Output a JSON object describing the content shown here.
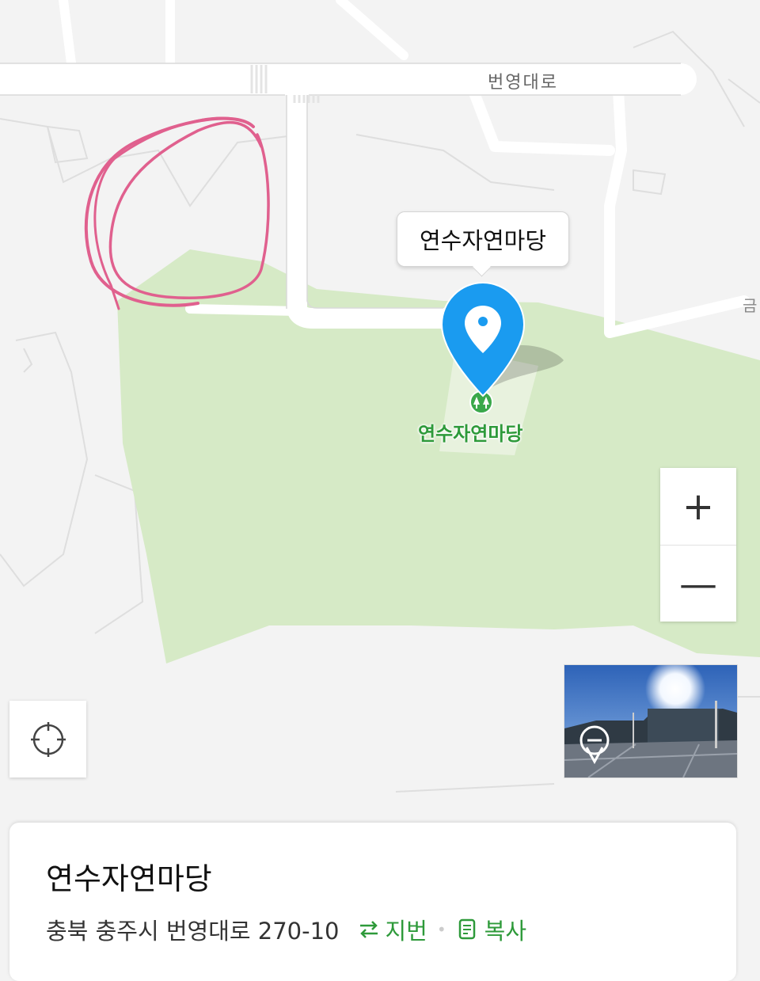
{
  "map": {
    "road_label": "번영대로",
    "road_label_2": "금",
    "callout_label": "연수자연마당",
    "place_label": "연수자연마당"
  },
  "controls": {
    "zoom_in": "+",
    "zoom_out": "—"
  },
  "place_card": {
    "title": "연수자연마당",
    "address": "충북 충주시 번영대로 270-10",
    "lot_button": "지번",
    "copy_button": "복사"
  },
  "colors": {
    "park": "#d6eac6",
    "pin": "#1a9bf0",
    "accent_green": "#2e9a3a",
    "annotation": "#e0608e"
  }
}
